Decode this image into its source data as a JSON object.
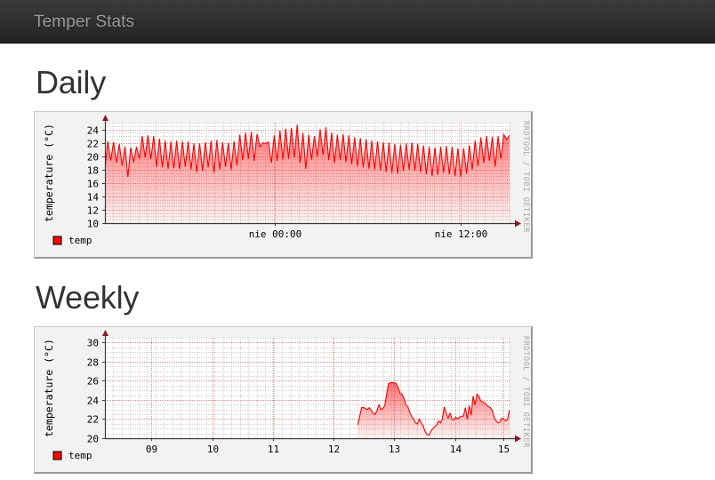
{
  "navbar": {
    "brand": "Temper Stats"
  },
  "sections": [
    {
      "id": "daily",
      "title": "Daily",
      "chart_key": "daily"
    },
    {
      "id": "weekly",
      "title": "Weekly",
      "chart_key": "weekly"
    }
  ],
  "common": {
    "watermark": "RRDTOOL / TOBI OETIKER",
    "legend_label": "temp",
    "legend_color": "#ff0000",
    "line_color": "#ff0000",
    "area_color": "#ffd0d0",
    "grid_minor_color": "#b0b0b0",
    "grid_major_color": "#e08d8d",
    "axis_color": "#3a3a3a",
    "arrow_color": "#8b1a1a",
    "panel_background": "#f2f2f2"
  },
  "chart_data": [
    {
      "key": "daily",
      "type": "line",
      "title": "Daily",
      "ylabel": "temperature (°C)",
      "xlabel": "",
      "ylim": [
        10,
        25
      ],
      "yticks": [
        10,
        12,
        14,
        16,
        18,
        20,
        22,
        24
      ],
      "ytick_labels": [
        "10",
        "12",
        "14",
        "16",
        "18",
        "20",
        "22",
        "24"
      ],
      "xtick_labels": [
        "nie 00:00",
        "nie 12:00"
      ],
      "xtick_positions": [
        0.42,
        0.88
      ],
      "grid": true,
      "legend": [
        "temp"
      ],
      "legend_position": "bottom-left",
      "series": [
        {
          "name": "temp",
          "values": [
            18.0,
            22.2,
            19.3,
            22.1,
            19.0,
            21.8,
            18.6,
            21.4,
            16.9,
            21.3,
            19.1,
            21.4,
            19.6,
            23.0,
            19.8,
            23.1,
            19.6,
            23.0,
            18.4,
            22.6,
            18.3,
            22.3,
            18.1,
            22.2,
            18.2,
            22.3,
            18.1,
            22.2,
            18.4,
            22.2,
            18.0,
            21.9,
            17.6,
            21.9,
            17.8,
            22.1,
            18.3,
            22.3,
            17.5,
            22.4,
            18.0,
            22.1,
            18.4,
            22.0,
            18.0,
            22.2,
            18.6,
            23.2,
            19.4,
            23.5,
            19.6,
            23.6,
            19.3,
            23.3,
            21.4,
            22.0,
            21.9,
            22.1,
            19.0,
            23.1,
            19.3,
            23.8,
            19.5,
            24.1,
            19.6,
            24.2,
            19.8,
            24.7,
            19.0,
            23.5,
            18.1,
            23.2,
            19.5,
            23.0,
            20.0,
            24.0,
            20.2,
            24.3,
            19.4,
            23.5,
            19.0,
            23.2,
            19.4,
            23.3,
            19.1,
            23.1,
            18.8,
            22.8,
            18.5,
            22.7,
            18.3,
            22.5,
            18.1,
            22.3,
            18.0,
            22.2,
            17.9,
            22.1,
            17.6,
            22.0,
            17.5,
            21.8,
            17.4,
            21.7,
            17.8,
            21.9,
            18.0,
            22.0,
            17.8,
            21.8,
            17.6,
            21.6,
            17.3,
            21.4,
            17.0,
            21.3,
            17.2,
            21.4,
            17.5,
            21.5,
            17.3,
            21.4,
            17.0,
            21.2,
            16.9,
            21.2,
            17.4,
            21.6,
            18.0,
            22.3,
            18.5,
            22.8,
            19.0,
            23.0,
            19.3,
            22.9,
            18.4,
            23.0,
            19.6,
            23.2,
            22.5,
            23.1
          ]
        }
      ]
    },
    {
      "key": "weekly",
      "type": "line",
      "title": "Weekly",
      "ylabel": "temperature (°C)",
      "xlabel": "",
      "ylim": [
        20,
        30.5
      ],
      "yticks": [
        20,
        22,
        24,
        26,
        28,
        30
      ],
      "ytick_labels": [
        "20",
        "22",
        "24",
        "26",
        "28",
        "30"
      ],
      "xtick_labels": [
        "09",
        "10",
        "11",
        "12",
        "13",
        "14",
        "15"
      ],
      "xtick_positions": [
        0.115,
        0.265,
        0.415,
        0.565,
        0.715,
        0.865,
        0.985
      ],
      "grid": true,
      "legend": [
        "temp"
      ],
      "legend_position": "bottom-left",
      "data_start_fraction": 0.625,
      "series": [
        {
          "name": "temp",
          "values": [
            21.4,
            22.3,
            23.2,
            23.2,
            23.1,
            23.0,
            23.2,
            22.9,
            22.6,
            22.5,
            22.9,
            23.5,
            23.0,
            23.1,
            23.4,
            24.6,
            25.7,
            25.8,
            25.8,
            25.8,
            25.7,
            25.3,
            24.7,
            24.6,
            24.2,
            23.5,
            23.3,
            22.7,
            22.3,
            22.0,
            21.6,
            21.5,
            22.0,
            21.6,
            21.3,
            20.7,
            20.4,
            20.3,
            20.7,
            21.0,
            21.2,
            21.4,
            21.8,
            21.6,
            22.0,
            23.3,
            22.6,
            22.1,
            22.6,
            22.0,
            21.9,
            22.2,
            22.0,
            22.2,
            22.3,
            22.3,
            23.2,
            22.0,
            23.4,
            22.4,
            24.4,
            23.5,
            24.6,
            24.4,
            23.9,
            23.8,
            23.7,
            23.5,
            23.3,
            23.2,
            22.9,
            22.2,
            21.8,
            21.6,
            21.7,
            22.1,
            22.0,
            21.8,
            22.0,
            23.0
          ]
        }
      ]
    }
  ]
}
